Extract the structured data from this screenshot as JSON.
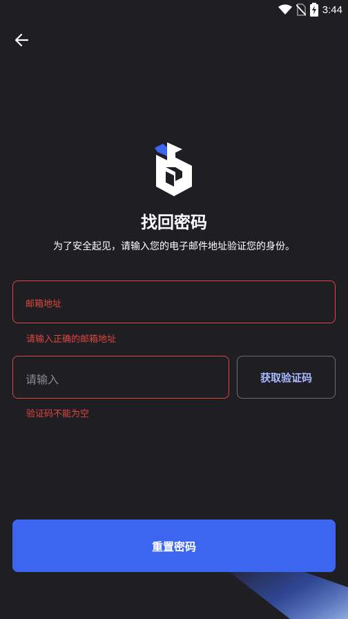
{
  "status_bar": {
    "time": "3:44"
  },
  "header": {
    "title": "找回密码",
    "subtitle": "为了安全起见，请输入您的电子邮件地址验证您的身份。"
  },
  "form": {
    "email": {
      "label": "邮箱地址",
      "error": "请输入正确的邮箱地址"
    },
    "code": {
      "placeholder": "请输入",
      "error": "验证码不能为空",
      "button_label": "获取验证码"
    },
    "submit_label": "重置密码"
  },
  "colors": {
    "background": "#1f1e23",
    "error": "#e0473f",
    "accent": "#3d66f0",
    "code_button_text": "#a9b9ff"
  },
  "icons": [
    "wifi-icon",
    "no-sim-icon",
    "battery-charging-icon",
    "back-arrow-icon",
    "app-logo-icon"
  ]
}
